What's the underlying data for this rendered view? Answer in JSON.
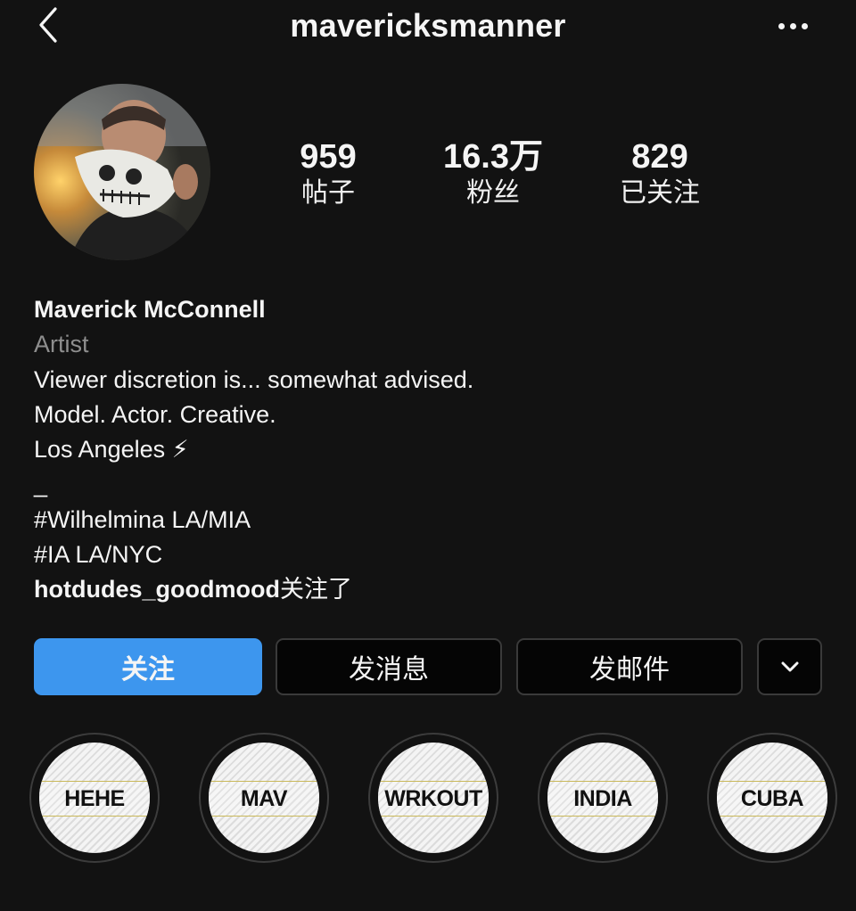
{
  "header": {
    "back_icon": "chevron-left-icon",
    "title": "mavericksmanner",
    "more_icon": "more-horizontal-icon"
  },
  "profile": {
    "avatar_description_icon": "profile-avatar",
    "stats": [
      {
        "value": "959",
        "label": "帖子"
      },
      {
        "value": "16.3万",
        "label": "粉丝"
      },
      {
        "value": "829",
        "label": "已关注"
      }
    ]
  },
  "bio": {
    "name": "Maverick McConnell",
    "category": "Artist",
    "lines": [
      "Viewer discretion is... somewhat advised.",
      "Model. Actor. Creative.",
      "Los Angeles ⚡",
      "_",
      "#Wilhelmina LA/MIA",
      "#IA LA/NYC"
    ],
    "followed_by_user": "hotdudes_goodmood",
    "followed_by_suffix": "关注了"
  },
  "actions": {
    "follow_label": "关注",
    "message_label": "发消息",
    "email_label": "发邮件",
    "more_icon": "chevron-down-icon"
  },
  "highlights": [
    {
      "label": "HEHE"
    },
    {
      "label": "MAV"
    },
    {
      "label": "WRKOUT"
    },
    {
      "label": "INDIA"
    },
    {
      "label": "CUBA"
    }
  ],
  "colors": {
    "background": "#121212",
    "primary_button": "#3d96ee",
    "secondary_text": "#8e8e8e"
  }
}
